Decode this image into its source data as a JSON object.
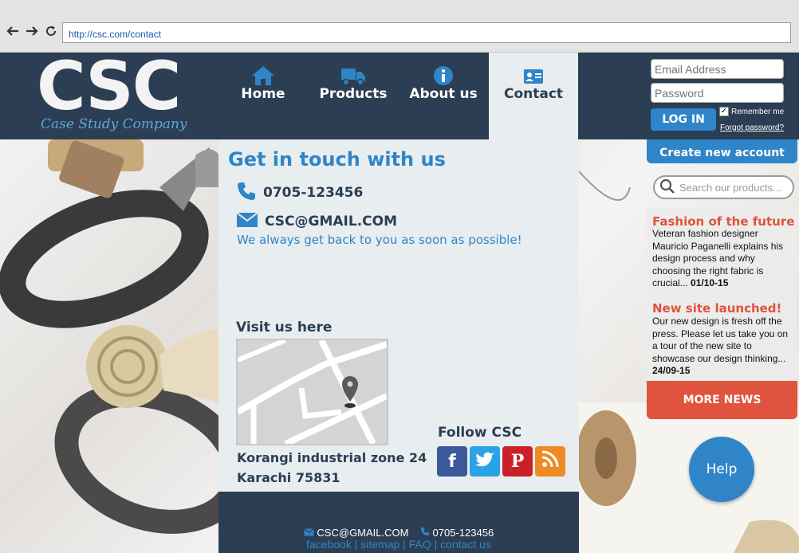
{
  "browser": {
    "url": "http://csc.com/contact"
  },
  "logo": {
    "title": "CSC",
    "subtitle": "Case Study Company"
  },
  "nav": {
    "items": [
      {
        "label": "Home",
        "icon": "home-icon"
      },
      {
        "label": "Products",
        "icon": "truck-icon"
      },
      {
        "label": "About us",
        "icon": "info-icon"
      },
      {
        "label": "Contact",
        "icon": "contact-card-icon"
      }
    ],
    "active": "Contact"
  },
  "login": {
    "email_placeholder": "Email Address",
    "password_placeholder": "Password",
    "button_label": "LOG IN",
    "remember_label": "Remember me",
    "remember_checked": true,
    "forgot_label": "Forgot password?"
  },
  "contact": {
    "title": "Get in touch with us",
    "phone": "0705-123456",
    "email": "CSC@GMAIL.COM",
    "note": "We always get back to you as soon as possible!",
    "visit_title": "Visit us here",
    "address_line1": "Korangi industrial zone 24",
    "address_line2": "Karachi 75831",
    "follow_title": "Follow CSC",
    "social": [
      {
        "name": "facebook",
        "glyph": "f",
        "color": "#3b5998"
      },
      {
        "name": "twitter",
        "glyph": "t",
        "color": "#2aa3e6"
      },
      {
        "name": "pinterest",
        "glyph": "P",
        "color": "#cb2027"
      },
      {
        "name": "rss",
        "glyph": "rss",
        "color": "#f08a24"
      }
    ]
  },
  "footer": {
    "email": "CSC@GMAIL.COM",
    "phone": "0705-123456",
    "links": [
      "facebook",
      "sitemap",
      "FAQ",
      "contact us"
    ]
  },
  "sidebar": {
    "create_account": "Create new account",
    "search_placeholder": "Search our products...",
    "news": [
      {
        "title": "Fashion of the future",
        "body": "Veteran fashion designer Mauricio Paganelli explains his design process and why choosing the right fabric is crucial...",
        "date": "01/10-15"
      },
      {
        "title": "New site launched!",
        "body": "Our new design is fresh off the press. Please let us take you on a tour of the new site to showcase our design thinking...",
        "date": "24/09-15"
      }
    ],
    "more_news": "MORE NEWS"
  },
  "help_label": "Help",
  "colors": {
    "header": "#2b3e53",
    "accent": "#2f85c8",
    "news_accent": "#e0533e",
    "panel": "#e8edf0"
  }
}
